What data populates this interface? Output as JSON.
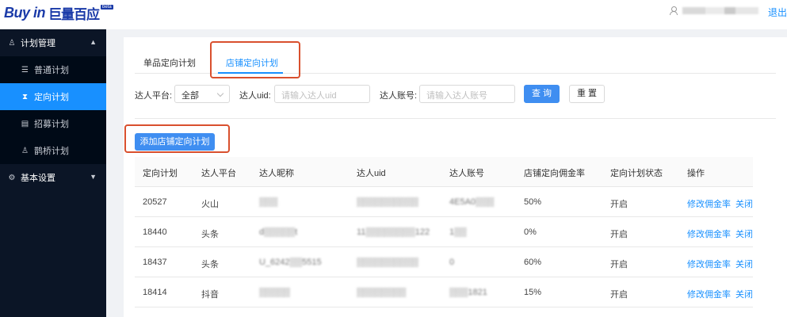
{
  "header": {
    "logo_text": "Buy in",
    "logo_cn": "巨量百应",
    "logo_badge": "beta",
    "user_name_masked": "",
    "logout_label": "退出"
  },
  "sidebar": {
    "group_plan": "计划管理",
    "items": [
      {
        "label": "普通计划",
        "icon": "list-icon"
      },
      {
        "label": "定向计划",
        "icon": "hourglass-icon",
        "active": true
      },
      {
        "label": "招募计划",
        "icon": "document-icon"
      },
      {
        "label": "鹊桥计划",
        "icon": "bridge-icon"
      }
    ],
    "group_settings": "基本设置"
  },
  "tabs": [
    "单品定向计划",
    "店铺定向计划"
  ],
  "active_tab": 1,
  "filters": {
    "platform_label": "达人平台:",
    "platform_value": "全部",
    "uid_label": "达人uid:",
    "uid_placeholder": "请输入达人uid",
    "account_label": "达人账号:",
    "account_placeholder": "请输入达人账号",
    "search_label": "查 询",
    "reset_label": "重 置"
  },
  "add_button_label": "添加店铺定向计划",
  "table": {
    "headers": [
      "定向计划",
      "达人平台",
      "达人昵称",
      "达人uid",
      "达人账号",
      "店铺定向佣金率",
      "定向计划状态",
      "操作"
    ],
    "rows": [
      {
        "plan": "20527",
        "platform": "火山",
        "nickname": "▒▒▒",
        "uid": "▒▒▒▒▒▒▒▒▒▒",
        "account": "4E5A0▒▒▒",
        "rate": "50%",
        "status": "开启"
      },
      {
        "plan": "18440",
        "platform": "头条",
        "nickname": "d▒▒▒▒▒t",
        "uid": "11▒▒▒▒▒▒▒▒122",
        "account": "1▒▒",
        "rate": "0%",
        "status": "开启"
      },
      {
        "plan": "18437",
        "platform": "头条",
        "nickname": "U_6242▒▒5515",
        "uid": "▒▒▒▒▒▒▒▒▒▒",
        "account": "0",
        "rate": "60%",
        "status": "开启"
      },
      {
        "plan": "18414",
        "platform": "抖音",
        "nickname": "▒▒▒▒▒",
        "uid": "▒▒▒▒▒▒▒▒",
        "account": "▒▒▒1821",
        "rate": "15%",
        "status": "开启"
      }
    ],
    "action_edit": "修改佣金率",
    "action_close": "关闭"
  },
  "colors": {
    "accent": "#1890ff",
    "sidebar_bg": "#0b1526",
    "highlight": "#d9502e"
  }
}
